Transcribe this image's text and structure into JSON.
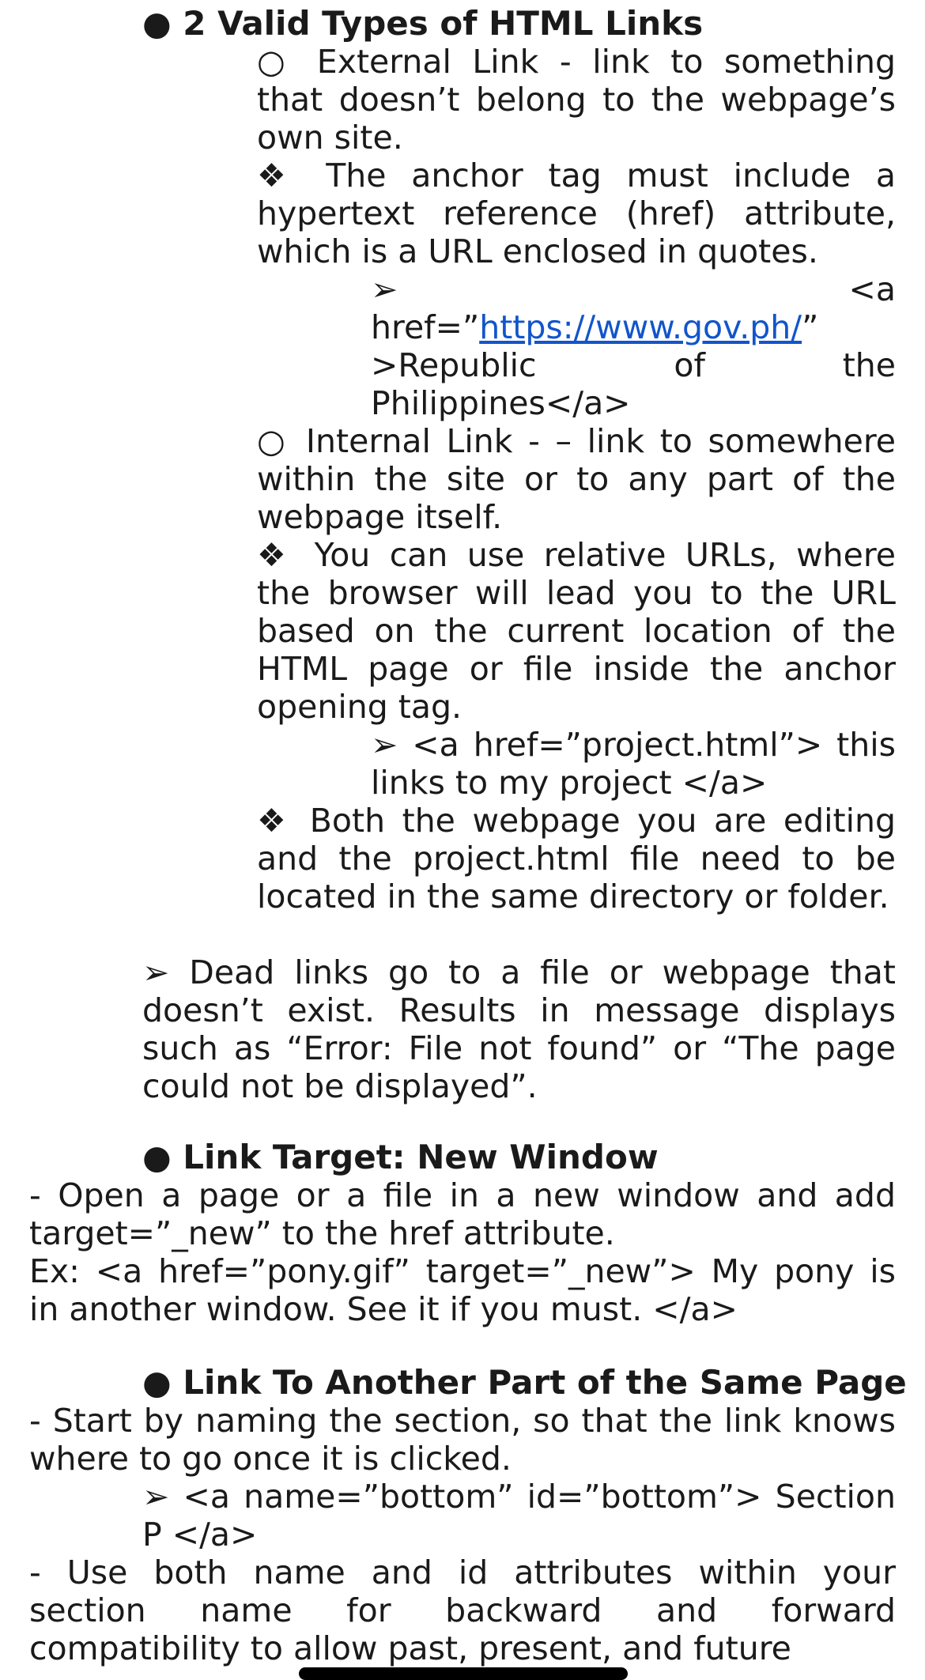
{
  "sections": {
    "valid_types": {
      "heading": "● 2 Valid Types of HTML Links",
      "external": "○ External Link - link to something that doesn’t belong to the webpage’s own site.",
      "external_note": "❖ The anchor tag must include a hypertext reference (href) attribute, which is a URL enclosed in quotes.",
      "external_example_prefix": "➢ <a href=”",
      "external_example_link": "https://www.gov.ph/",
      "external_example_suffix": "” >Republic of the Philippines</a>",
      "internal": "○ Internal Link - – link to somewhere within the site or to any part of the webpage itself.",
      "internal_note": "❖ You can use relative URLs, where the browser will lead you to the URL based on the current location of the HTML page or file inside the anchor opening tag.",
      "internal_example": "➢ <a href=”project.html”> this links to my project </a>",
      "internal_note2": "❖ Both the webpage you are editing and the project.html file need to be located in the same directory or folder.",
      "dead_links": "➢ Dead links go to a file or webpage that doesn’t exist. Results in message displays such as “Error: File not found” or “The page could not be displayed”."
    },
    "new_window": {
      "heading": "● Link Target: New Window",
      "body": "- Open a page or a file in a new window and add target=”_new” to the href attribute.",
      "example": "Ex: <a href=”pony.gif” target=”_new”> My pony is in another window. See it if you must. </a>"
    },
    "same_page": {
      "heading": "● Link To Another Part of the Same Page",
      "body": "- Start by naming the section, so that the link knows where to go once it is clicked.",
      "example": "➢ <a name=”bottom” id=”bottom”> Section P </a>",
      "body2": "- Use both name and id attributes within your section name for backward and forward compatibility to allow past, present, and future"
    }
  },
  "colors": {
    "text": "#1a1a1a",
    "link": "#1155cc",
    "background": "#ffffff"
  }
}
